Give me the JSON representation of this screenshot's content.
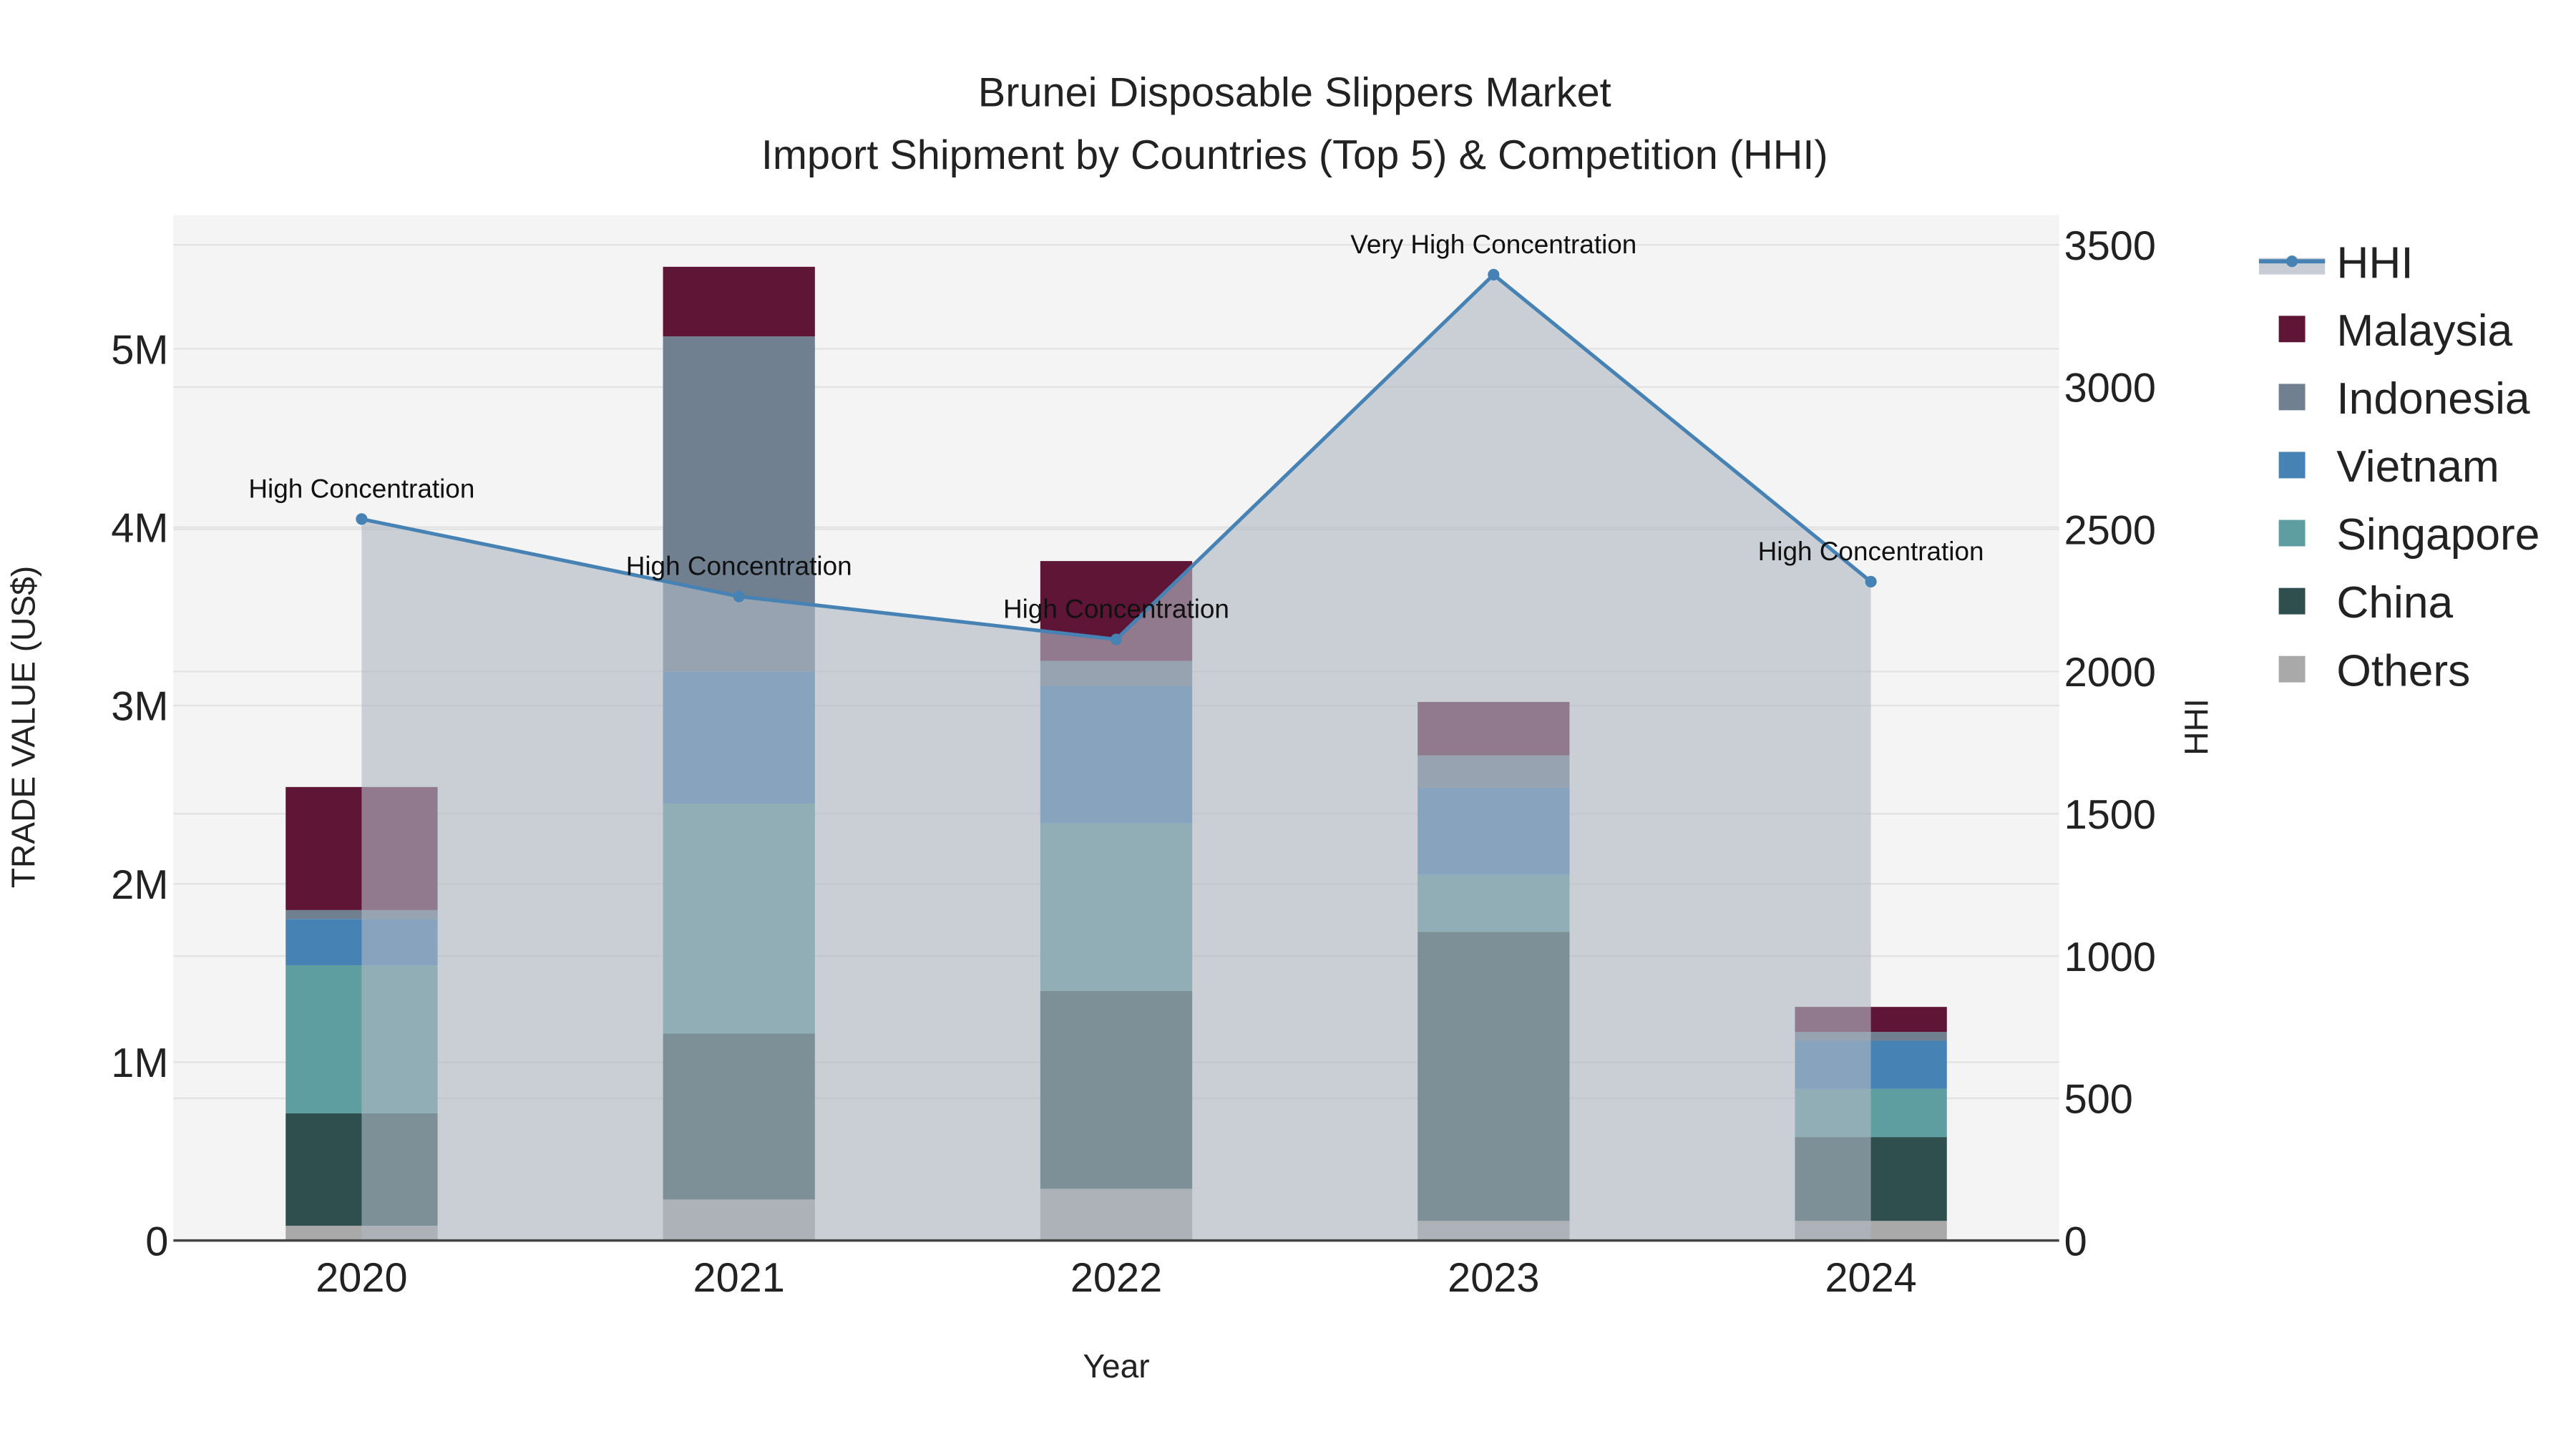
{
  "chart_data": {
    "type": "bar",
    "title": "Brunei Disposable Slippers Market",
    "subtitle": "Import Shipment by Countries (Top 5) & Competition (HHI)",
    "xlabel": "Year",
    "ylabel": "TRADE VALUE (US$)",
    "y2label": "HHI",
    "categories": [
      "2020",
      "2021",
      "2022",
      "2023",
      "2024"
    ],
    "ylim": [
      0,
      5700000
    ],
    "y2lim": [
      0,
      3600
    ],
    "yticks": [
      {
        "v": 0,
        "label": "0"
      },
      {
        "v": 1000000,
        "label": "1M"
      },
      {
        "v": 2000000,
        "label": "2M"
      },
      {
        "v": 3000000,
        "label": "3M"
      },
      {
        "v": 4000000,
        "label": "4M"
      },
      {
        "v": 5000000,
        "label": "5M"
      }
    ],
    "y2ticks": [
      {
        "v": 0,
        "label": "0"
      },
      {
        "v": 500,
        "label": "500"
      },
      {
        "v": 1000,
        "label": "1000"
      },
      {
        "v": 1500,
        "label": "1500"
      },
      {
        "v": 2000,
        "label": "2000"
      },
      {
        "v": 2500,
        "label": "2500"
      },
      {
        "v": 3000,
        "label": "3000"
      },
      {
        "v": 3500,
        "label": "3500"
      }
    ],
    "stacked": true,
    "series": [
      {
        "name": "Others",
        "color": "#a9a9a9",
        "values": [
          83000,
          230000,
          290000,
          110000,
          110000
        ]
      },
      {
        "name": "China",
        "color": "#2f4f4f",
        "values": [
          630000,
          930000,
          1110000,
          1620000,
          470000
        ]
      },
      {
        "name": "Singapore",
        "color": "#5f9ea0",
        "values": [
          830000,
          1290000,
          940000,
          320000,
          270000
        ]
      },
      {
        "name": "Vietnam",
        "color": "#4682b4",
        "values": [
          260000,
          740000,
          770000,
          490000,
          270000
        ]
      },
      {
        "name": "Indonesia",
        "color": "#708090",
        "values": [
          50000,
          1880000,
          140000,
          180000,
          50000
        ]
      },
      {
        "name": "Malaysia",
        "color": "#5f1536",
        "values": [
          690000,
          390000,
          560000,
          300000,
          140000
        ]
      }
    ],
    "hhi": {
      "name": "HHI",
      "color": "#4682b4",
      "values": [
        2536,
        2264,
        2113,
        3395,
        2316
      ],
      "annotations": [
        "High Concentration",
        "High Concentration",
        "High Concentration",
        "Very High Concentration",
        "High Concentration"
      ]
    },
    "legend": {
      "placement": "right",
      "order": [
        "HHI",
        "Malaysia",
        "Indonesia",
        "Vietnam",
        "Singapore",
        "China",
        "Others"
      ]
    },
    "grid": true
  }
}
